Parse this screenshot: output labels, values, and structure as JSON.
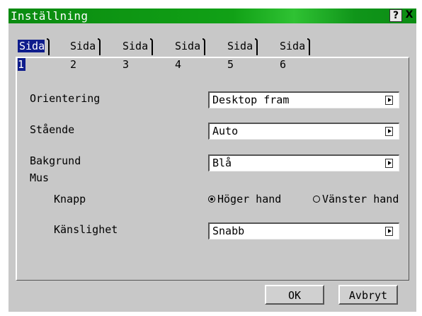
{
  "window": {
    "title": "Inställning",
    "help_label": "?",
    "close_label": "X"
  },
  "tabs": [
    {
      "label": "Sida 1",
      "active": true
    },
    {
      "label": "Sida 2"
    },
    {
      "label": "Sida 3"
    },
    {
      "label": "Sida 4"
    },
    {
      "label": "Sida 5"
    },
    {
      "label": "Sida 6"
    }
  ],
  "settings": {
    "orientation": {
      "label": "Orientering",
      "value": "Desktop fram"
    },
    "standing": {
      "label": "Stående",
      "value": "Auto"
    },
    "background": {
      "label": "Bakgrund",
      "value": "Blå"
    },
    "mouse": {
      "label": "Mus",
      "button_label": "Knapp",
      "right_hand": "Höger hand",
      "left_hand": "Vänster hand",
      "sensitivity_label": "Känslighet",
      "sensitivity_value": "Snabb"
    }
  },
  "footer": {
    "ok_label": "OK",
    "cancel_label": "Avbryt"
  }
}
